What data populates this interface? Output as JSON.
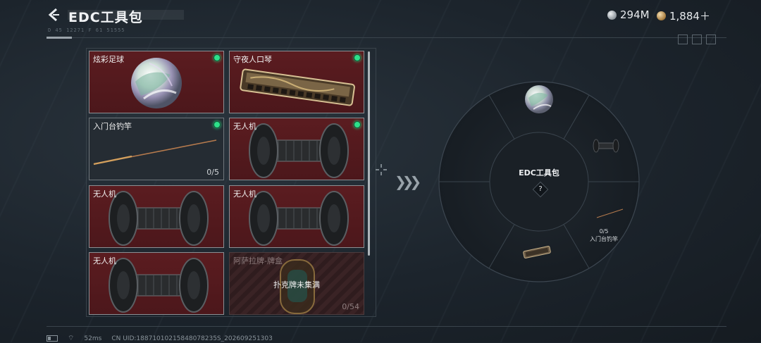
{
  "header": {
    "title": "EDC工具包",
    "coord_text": "D 45  12271      F 61  51555"
  },
  "currency": [
    {
      "name": "silver-coin",
      "value": "294M",
      "color": "#b9c0c6"
    },
    {
      "name": "gold-coin",
      "value": "1,884＋",
      "color": "#c9a56b"
    }
  ],
  "items": [
    {
      "name": "炫彩足球",
      "style": "red",
      "equipped": true,
      "art": "orb",
      "count": ""
    },
    {
      "name": "守夜人口琴",
      "style": "red",
      "equipped": true,
      "art": "harmonica",
      "count": ""
    },
    {
      "name": "入门台钓竿",
      "style": "dark",
      "equipped": true,
      "art": "rod",
      "count": "0/5"
    },
    {
      "name": "无人机",
      "style": "red",
      "equipped": true,
      "art": "drone",
      "count": ""
    },
    {
      "name": "无人机",
      "style": "red",
      "equipped": false,
      "art": "drone",
      "count": ""
    },
    {
      "name": "无人机",
      "style": "red",
      "equipped": false,
      "art": "drone",
      "count": ""
    },
    {
      "name": "无人机",
      "style": "red",
      "equipped": false,
      "art": "drone",
      "count": ""
    },
    {
      "name": "阿萨拉牌-牌盒",
      "style": "locked",
      "equipped": false,
      "art": "cardbox",
      "count": "0/54",
      "lock_message": "扑克牌未集满"
    }
  ],
  "wheel": {
    "center_title": "EDC工具包",
    "center_hint": "?",
    "slots": [
      {
        "position": "top",
        "art": "orb"
      },
      {
        "position": "upper-right",
        "art": "drone"
      },
      {
        "position": "lower-right",
        "art": "rod",
        "count": "0/5",
        "label": "入门台钓竿"
      },
      {
        "position": "bottom",
        "art": "harmonica"
      },
      {
        "position": "lower-left",
        "art": "empty"
      },
      {
        "position": "upper-left",
        "art": "empty"
      }
    ]
  },
  "status": {
    "ping": "52ms",
    "uid": "CN UID:18871010215848078235S_202609251303"
  }
}
